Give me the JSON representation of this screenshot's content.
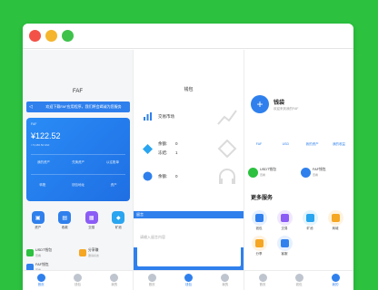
{
  "window": {
    "buttons": [
      "close",
      "minimize",
      "zoom"
    ]
  },
  "home": {
    "title": "FAF",
    "notice": "欢迎下载FAF应用程序，我们将会竭诚为您服务",
    "card": {
      "label": "FAF",
      "balance": "¥122.52",
      "sub": "≈ 5,180.52 FAF",
      "row1": [
        "我的资产",
        "兑换资产",
        "以往账单"
      ],
      "row2": [
        "转账",
        "钱包地址",
        "资产"
      ]
    },
    "shortcuts": [
      {
        "label": "资产",
        "color": "#2f80ed"
      },
      {
        "label": "收款",
        "color": "#2f80ed"
      },
      {
        "label": "交易",
        "color": "#8b5cf6"
      },
      {
        "label": "矿池",
        "color": "#2aa5f0"
      }
    ],
    "list": [
      {
        "title": "USDT钱包",
        "sub": "查看",
        "color": "#2cc13f"
      },
      {
        "title": "分享赚",
        "sub": "邀请好友",
        "color": "#f5a623"
      },
      {
        "title": "FAF钱包",
        "sub": "查看",
        "color": "#2f80ed"
      }
    ],
    "tabs": [
      "首页",
      "钱包",
      "我的"
    ]
  },
  "wallet": {
    "title": "钱包",
    "market": "交易市场",
    "balance_label": "余额:",
    "balance_value": "0",
    "frozen_label": "冻结:",
    "frozen_value": "1",
    "balance2_label": "余额:",
    "balance2_value": "0",
    "dialog_title": "留言",
    "dialog_placeholder": "请输入留言内容",
    "confirm": "确定",
    "tabs": [
      "首页",
      "钱包",
      "我的"
    ]
  },
  "profile": {
    "name": "钱袋",
    "sub": "欢迎来到我的FAF",
    "stats": [
      "FAF",
      "USD",
      "我的资产",
      "我的收益"
    ],
    "wallets": [
      {
        "title": "USDT钱包",
        "sub": "查看",
        "color": "#2cc13f"
      },
      {
        "title": "FAF钱包",
        "sub": "查看",
        "color": "#2f80ed"
      }
    ],
    "more_title": "更多服务",
    "services": [
      {
        "label": "钱包",
        "color": "#2f80ed"
      },
      {
        "label": "交易",
        "color": "#8b5cf6"
      },
      {
        "label": "矿池",
        "color": "#2aa5f0"
      },
      {
        "label": "商城",
        "color": "#f5a623"
      },
      {
        "label": "分享",
        "color": "#f5a623"
      },
      {
        "label": "客服",
        "color": "#2f80ed"
      }
    ],
    "tabs": [
      "首页",
      "钱包",
      "我的"
    ]
  }
}
